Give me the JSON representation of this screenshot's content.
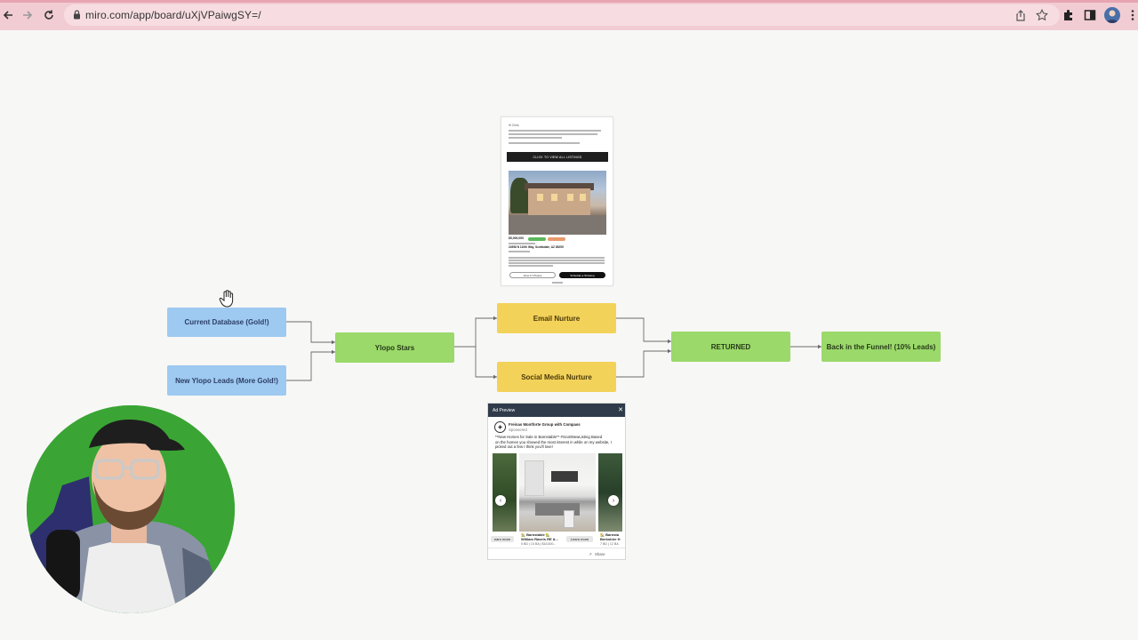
{
  "browser": {
    "url": "miro.com/app/board/uXjVPaiwgSY=/"
  },
  "board": {
    "nodes": {
      "current_database": "Current Database (Gold!)",
      "new_leads": "New Ylopo Leads (More Gold!)",
      "ylopo_stars": "Ylopo Stars",
      "email_nurture": "Email Nurture",
      "social_nurture": "Social Media Nurture",
      "returned": "RETURNED",
      "back_in_funnel": "Back in the Funnel! (10% Leads)"
    },
    "colors": {
      "source": "#9ec9f0",
      "stage": "#9bd96a",
      "nurture": "#f3d25a"
    }
  },
  "email_preview": {
    "greeting": "Hi Chris,",
    "cta": "CLICK TO VIEW ALL LISTINGS",
    "price": "$5,000,000",
    "address": "24958 N 110th Way, Scottsdale, AZ 85255",
    "view_button": "View 17 Photos",
    "schedule_button": "Schedule a Showing"
  },
  "ad_preview": {
    "title": "Ad Preview",
    "advertiser": "Freinas Montforte Group with Compass",
    "sponsored": "Sponsored",
    "body_line1": "**New Homes for Sale in Barnstable** #ScottNewListing Based",
    "body_line2": "on the homes you showed the most interest in while on my website, I",
    "body_line3": "picked out a few I think you'll love!",
    "card1_cta": "earn more",
    "card2_title": "🏡 Barnstable 🏡",
    "card2_sub": "William Raveis RE &...",
    "card2_meta": "5 BD | 10 BA | $16,500...",
    "card2_cta": "Learn more",
    "card3_title": "🏡 Barnsta",
    "card3_sub": "Berkshire H",
    "card3_meta": "7 BD | 12 BA",
    "share": "Share"
  }
}
